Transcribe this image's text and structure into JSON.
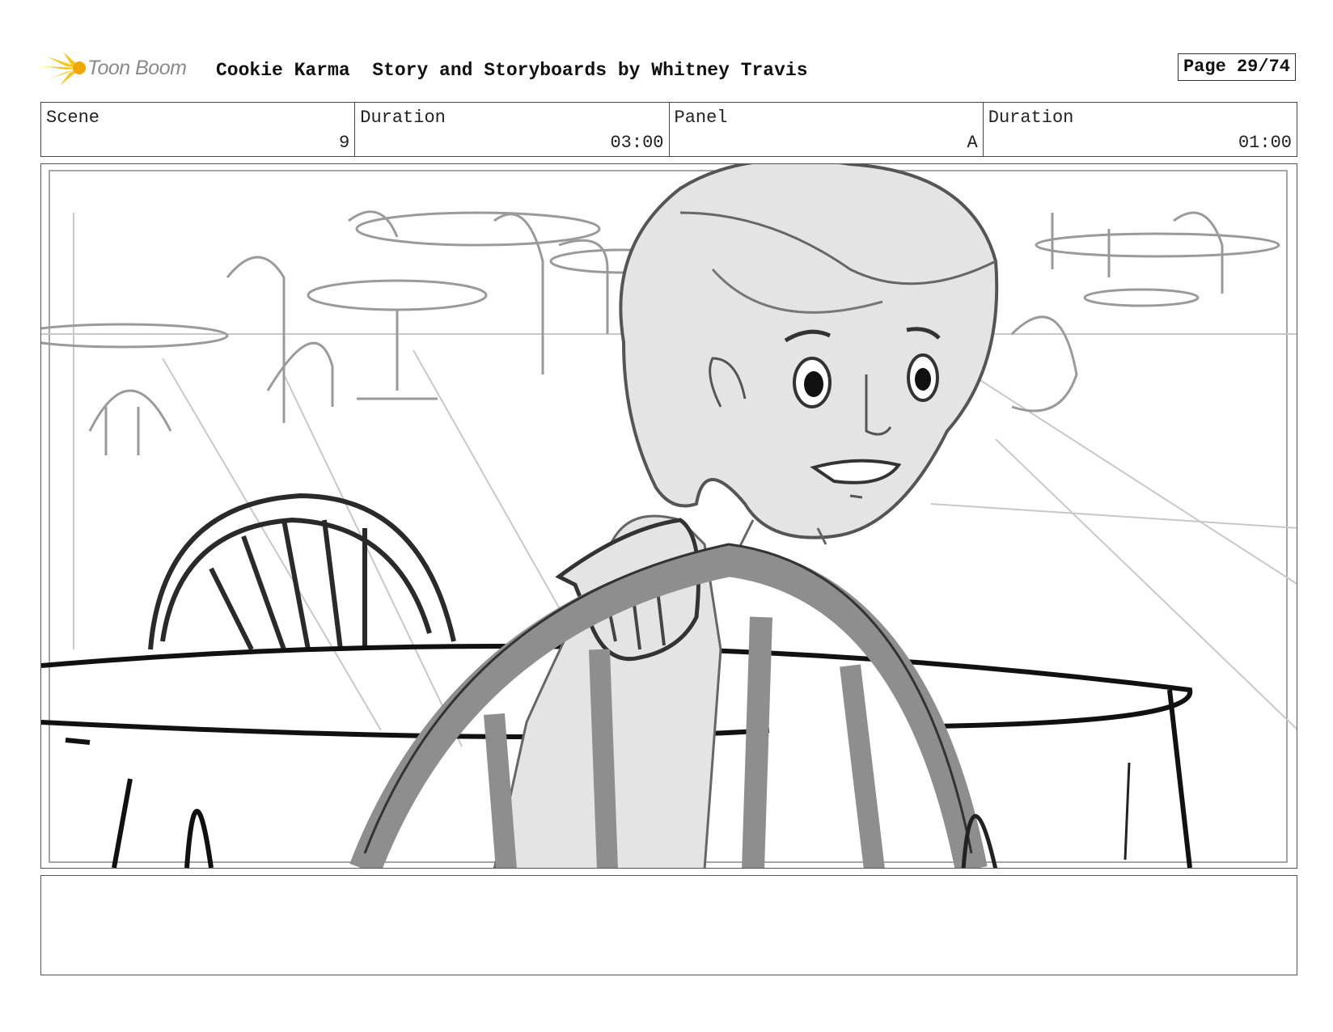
{
  "header": {
    "logo_text": "Toon Boom",
    "project_title": "Cookie Karma  Story and Storyboards by Whitney Travis",
    "page_label": "Page 29/74"
  },
  "info": {
    "scene_label": "Scene",
    "scene_value": "9",
    "scene_duration_label": "Duration",
    "scene_duration_value": "03:00",
    "panel_label": "Panel",
    "panel_value": "A",
    "panel_duration_label": "Duration",
    "panel_duration_value": "01:00"
  },
  "panel": {
    "image_description": "pencil sketch: girl at diner table seen from behind a chair"
  },
  "notes": {
    "text": ""
  }
}
